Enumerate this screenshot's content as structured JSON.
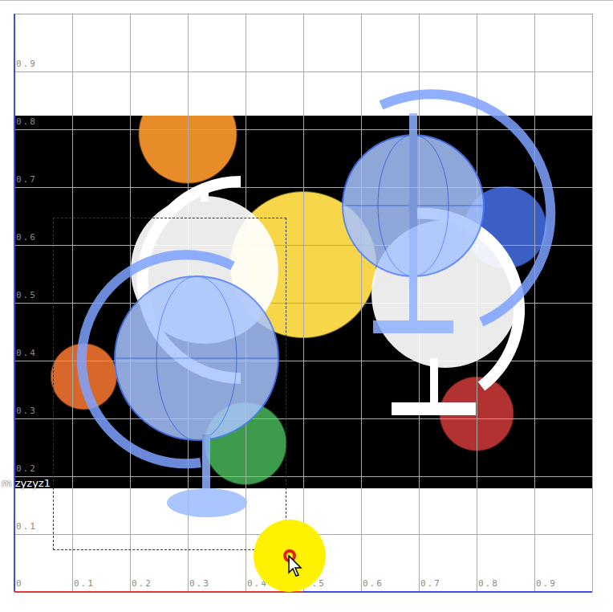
{
  "canvas": {
    "y_ticks": [
      "0.1",
      "0.2",
      "0.3",
      "0.4",
      "0.5",
      "0.6",
      "0.7",
      "0.8",
      "0.9"
    ],
    "x_ticks": [
      "0",
      "0.1",
      "0.2",
      "0.3",
      "0.4",
      "0.5",
      "0.6",
      "0.7",
      "0.8",
      "0.9"
    ],
    "selected_object": {
      "label": "m zyzyz1",
      "selected": true
    }
  }
}
